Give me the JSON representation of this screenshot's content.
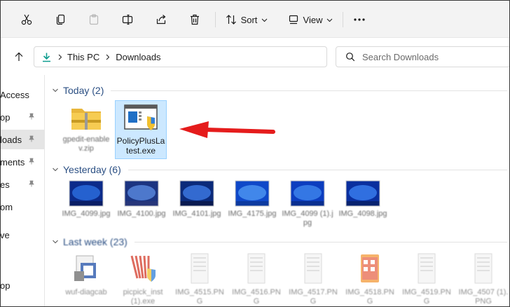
{
  "toolbar": {
    "sort_label": "Sort",
    "view_label": "View"
  },
  "address": {
    "crumbs": [
      "This PC",
      "Downloads"
    ]
  },
  "search": {
    "placeholder": "Search Downloads"
  },
  "sidebar": {
    "items": [
      {
        "label": "Access",
        "pinned": false
      },
      {
        "label": "op",
        "pinned": true
      },
      {
        "label": "loads",
        "pinned": true,
        "selected": true
      },
      {
        "label": "ments",
        "pinned": true
      },
      {
        "label": "es",
        "pinned": true
      },
      {
        "label": "om",
        "pinned": false
      },
      {
        "label": "ve",
        "pinned": false
      },
      {
        "label": "op",
        "pinned": false
      }
    ]
  },
  "groups": {
    "today": {
      "label": "Today (2)"
    },
    "yesterday": {
      "label": "Yesterday (6)"
    },
    "last_week": {
      "label": "Last week (23)"
    }
  },
  "files": {
    "today": [
      {
        "name": "gpedit-enablev.zip",
        "icon": "zip-folder-icon",
        "blurred": true
      },
      {
        "name": "PolicyPlusLatest.exe",
        "icon": "policyplus-app-icon",
        "selected": true
      }
    ],
    "yesterday": [
      {
        "name": "IMG_4099.jpg"
      },
      {
        "name": "IMG_4100.jpg"
      },
      {
        "name": "IMG_4101.jpg"
      },
      {
        "name": "IMG_4175.jpg"
      },
      {
        "name": "IMG_4099 (1).jpg"
      },
      {
        "name": "IMG_4098.jpg"
      }
    ],
    "last_week": [
      {
        "name": "wuf-diagcab"
      },
      {
        "name": "picpick_inst (1).exe"
      },
      {
        "name": "IMG_4515.PNG"
      },
      {
        "name": "IMG_4516.PNG"
      },
      {
        "name": "IMG_4517.PNG"
      },
      {
        "name": "IMG_4518.PNG"
      },
      {
        "name": "IMG_4519.PNG"
      },
      {
        "name": "IMG_4507 (1).PNG"
      }
    ]
  },
  "colors": {
    "toolbar_bg": "#f3f3f3",
    "selection_bg": "#cce8ff",
    "group_header": "#2b4f83",
    "arrow": "#e51c1c",
    "download_accent": "#0f9d8f"
  }
}
